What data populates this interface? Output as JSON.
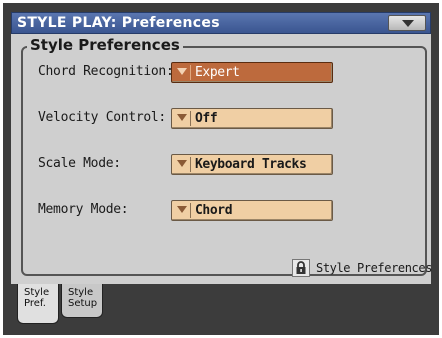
{
  "window": {
    "title": "STYLE PLAY: Preferences"
  },
  "group": {
    "title": "Style Preferences"
  },
  "rows": [
    {
      "label": "Chord Recognition:",
      "value": "Expert",
      "selected": true
    },
    {
      "label": "Velocity Control:",
      "value": "Off",
      "selected": false
    },
    {
      "label": "Scale Mode:",
      "value": "Keyboard Tracks",
      "selected": false
    },
    {
      "label": "Memory Mode:",
      "value": "Chord",
      "selected": false
    }
  ],
  "lock": {
    "label": "Style Preferences",
    "icon": "lock-icon"
  },
  "tabs": [
    {
      "line1": "Style",
      "line2": "Pref.",
      "active": true
    },
    {
      "line1": "Style",
      "line2": "Setup",
      "active": false
    }
  ],
  "colors": {
    "title_bar": "#3a5590",
    "panel": "#cfcfcf",
    "dropdown": "#f0cfa4",
    "dropdown_selected": "#bd6a3d"
  }
}
